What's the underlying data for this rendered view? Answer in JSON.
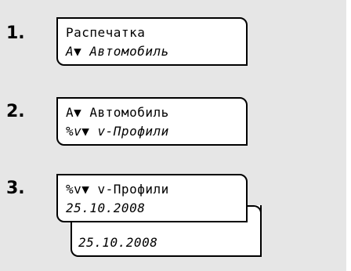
{
  "steps": [
    {
      "number": "1.",
      "line1": "Распечатка",
      "line2": "A▼ Автомобиль"
    },
    {
      "number": "2.",
      "line1": "A▼ Автомобиль",
      "line2": "%v▼ v-Профили"
    },
    {
      "number": "3.",
      "line1": "%v▼ v-Профили",
      "line2": "25.10.2008",
      "line3": "25.10.2008"
    }
  ]
}
